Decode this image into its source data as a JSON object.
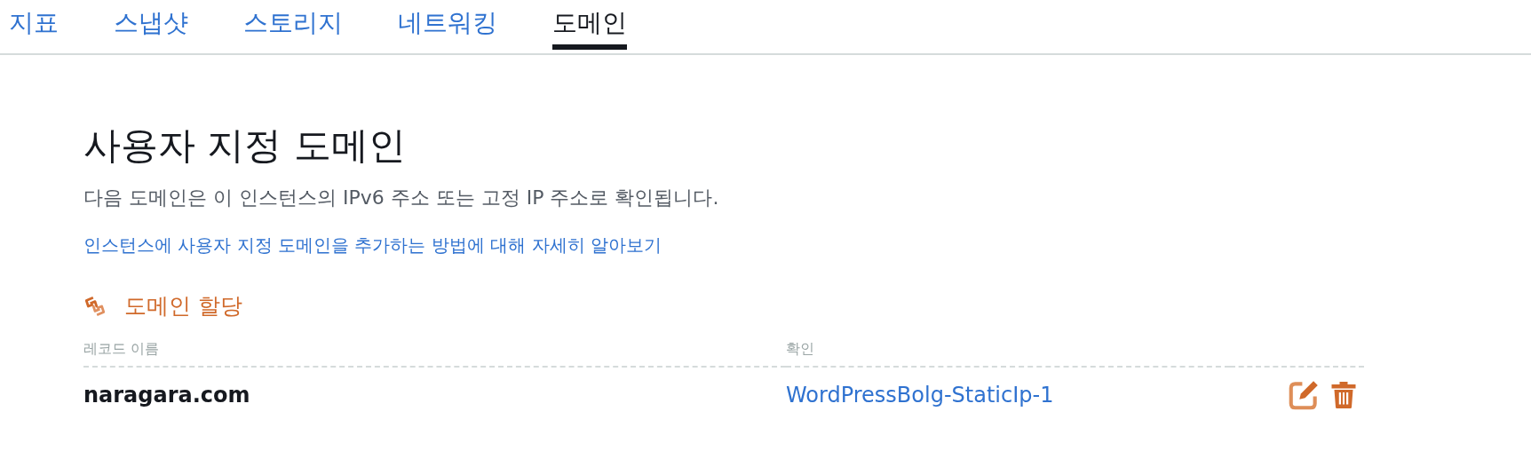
{
  "tabs": [
    {
      "label": "지표",
      "selected": false
    },
    {
      "label": "스냅샷",
      "selected": false
    },
    {
      "label": "스토리지",
      "selected": false
    },
    {
      "label": "네트워킹",
      "selected": false
    },
    {
      "label": "도메인",
      "selected": true
    }
  ],
  "section": {
    "title": "사용자 지정 도메인",
    "description": "다음 도메인은 이 인스턴스의 IPv6 주소 또는 고정 IP 주소로 확인됩니다.",
    "help_link": "인스턴스에 사용자 지정 도메인을 추가하는 방법에 대해 자세히 알아보기",
    "assign_button": "도메인 할당"
  },
  "table": {
    "columns": [
      "레코드 이름",
      "확인"
    ],
    "rows": [
      {
        "record_name": "naragara.com",
        "resolves_to": "WordPressBolg-StaticIp-1"
      }
    ]
  }
}
